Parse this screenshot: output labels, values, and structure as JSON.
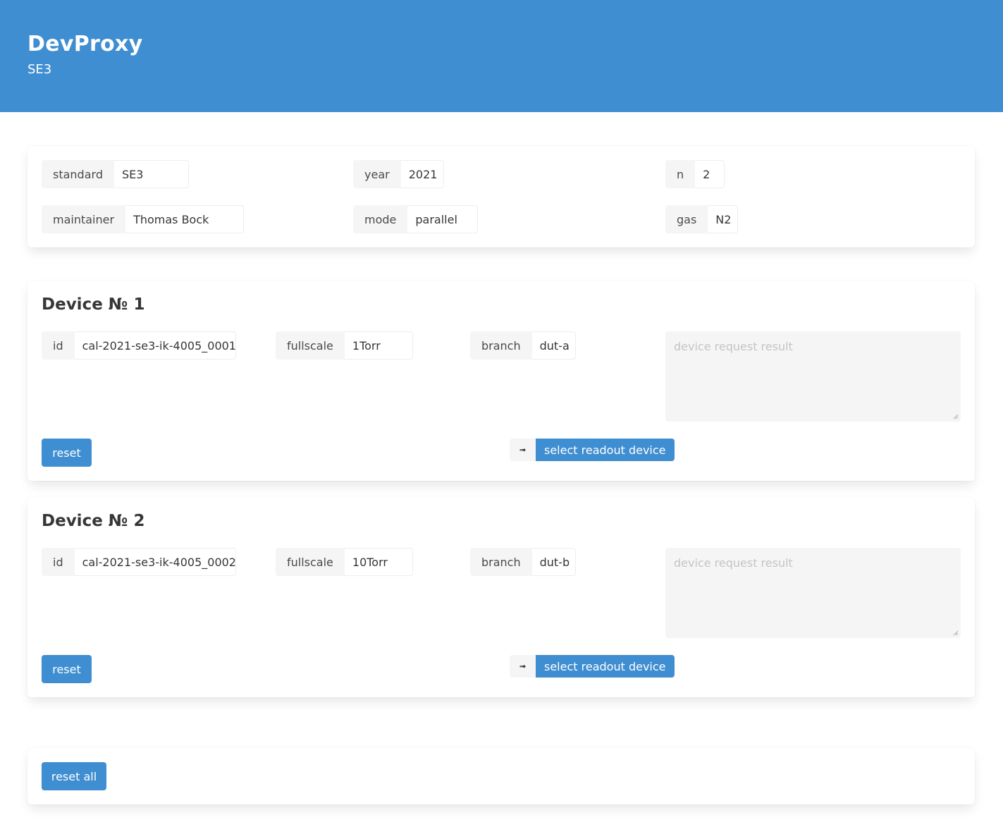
{
  "header": {
    "title": "DevProxy",
    "subtitle": "SE3"
  },
  "info": {
    "standard": {
      "label": "standard",
      "value": "SE3"
    },
    "year": {
      "label": "year",
      "value": "2021"
    },
    "n": {
      "label": "n",
      "value": "2"
    },
    "maintainer": {
      "label": "maintainer",
      "value": "Thomas Bock"
    },
    "mode": {
      "label": "mode",
      "value": "parallel"
    },
    "gas": {
      "label": "gas",
      "value": "N2"
    }
  },
  "devices": [
    {
      "title": "Device № 1",
      "id": {
        "label": "id",
        "value": "cal-2021-se3-ik-4005_0001"
      },
      "fullscale": {
        "label": "fullscale",
        "value": "1Torr"
      },
      "branch": {
        "label": "branch",
        "value": "dut-a"
      },
      "result_placeholder": "device request result",
      "reset_label": "reset",
      "readout_arrow": "➟",
      "readout_label": "select readout device"
    },
    {
      "title": "Device № 2",
      "id": {
        "label": "id",
        "value": "cal-2021-se3-ik-4005_0002"
      },
      "fullscale": {
        "label": "fullscale",
        "value": "10Torr"
      },
      "branch": {
        "label": "branch",
        "value": "dut-b"
      },
      "result_placeholder": "device request result",
      "reset_label": "reset",
      "readout_arrow": "➟",
      "readout_label": "select readout device"
    }
  ],
  "footer": {
    "reset_all_label": "reset all"
  },
  "colors": {
    "primary": "#3f8ed1",
    "label_bg": "#f5f5f5",
    "text": "#363636"
  }
}
